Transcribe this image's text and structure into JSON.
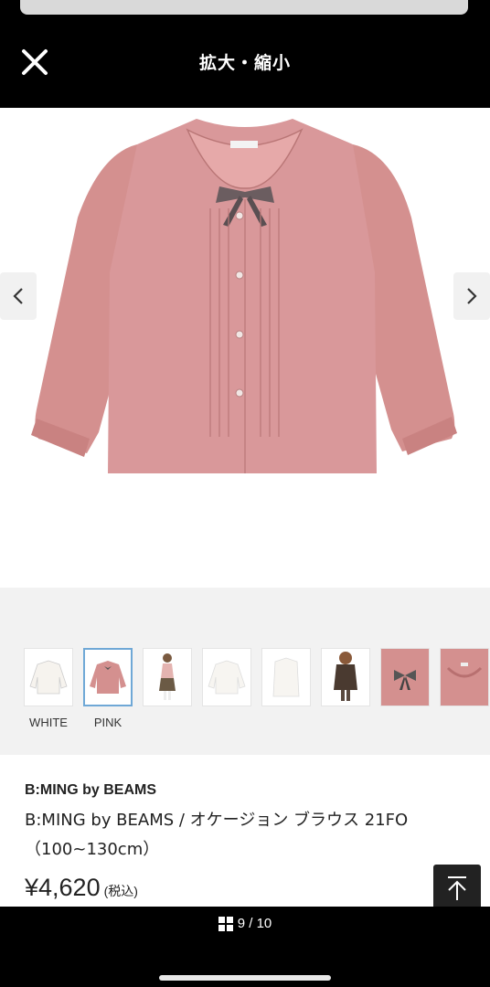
{
  "header": {
    "title": "拡大・縮小",
    "close_icon": "close-icon"
  },
  "viewer": {
    "prev_icon": "chevron-left-icon",
    "next_icon": "chevron-right-icon",
    "image_desc": "pink-blouse"
  },
  "thumbnails": [
    {
      "label": "WHITE",
      "kind": "white-blouse"
    },
    {
      "label": "PINK",
      "kind": "pink-blouse",
      "selected": true
    },
    {
      "label": "",
      "kind": "child-model-pink"
    },
    {
      "label": "",
      "kind": "white-blouse-flat"
    },
    {
      "label": "",
      "kind": "white-blouse-flat-2"
    },
    {
      "label": "",
      "kind": "child-model-dark"
    },
    {
      "label": "",
      "kind": "pink-detail-bow"
    },
    {
      "label": "",
      "kind": "pink-detail-collar"
    }
  ],
  "product": {
    "brand": "B:MING by BEAMS",
    "title": "B:MING by BEAMS / オケージョン ブラウス 21FO（100~130cm）",
    "price": "¥4,620",
    "tax_label": "(税込)"
  },
  "pager": {
    "text": "9 / 10",
    "icon": "grid-icon"
  },
  "colors": {
    "pink": "#d4908f",
    "accent_border": "#6fa8d6"
  }
}
